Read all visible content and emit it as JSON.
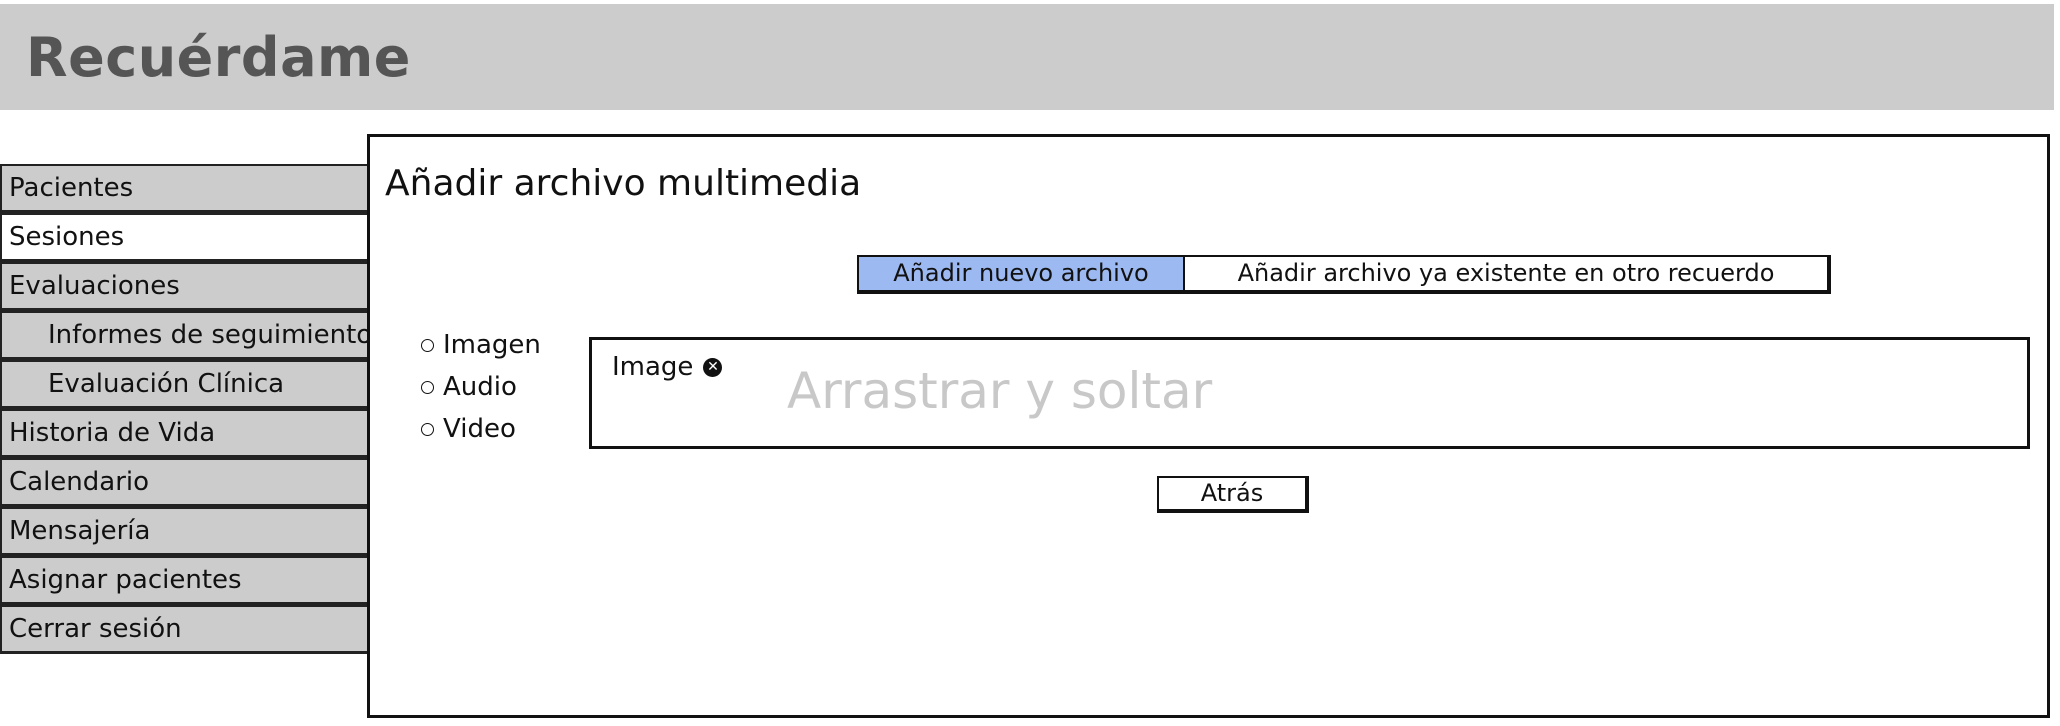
{
  "app": {
    "title": "Recuérdame"
  },
  "sidebar": {
    "items": [
      {
        "label": "Pacientes"
      },
      {
        "label": "Sesiones"
      },
      {
        "label": "Evaluaciones"
      },
      {
        "label": "Informes de seguimiento"
      },
      {
        "label": "Evaluación Clínica"
      },
      {
        "label": "Historia de Vida"
      },
      {
        "label": "Calendario"
      },
      {
        "label": "Mensajería"
      },
      {
        "label": "Asignar pacientes"
      },
      {
        "label": "Cerrar sesión"
      }
    ]
  },
  "main": {
    "title": "Añadir archivo multimedia",
    "tabs": [
      {
        "label": "Añadir nuevo archivo"
      },
      {
        "label": "Añadir archivo ya existente en otro recuerdo"
      }
    ],
    "media_types": [
      {
        "label": "Imagen"
      },
      {
        "label": "Audio"
      },
      {
        "label": "Video"
      }
    ],
    "dropzone": {
      "chip_label": "Image",
      "hint": "Arrastrar y soltar"
    },
    "back_label": "Atrás"
  },
  "colors": {
    "header_bg": "#cccccc",
    "title_text": "#555555",
    "active_tab": "#9db9f2",
    "hint_text": "#c8c8c8"
  }
}
